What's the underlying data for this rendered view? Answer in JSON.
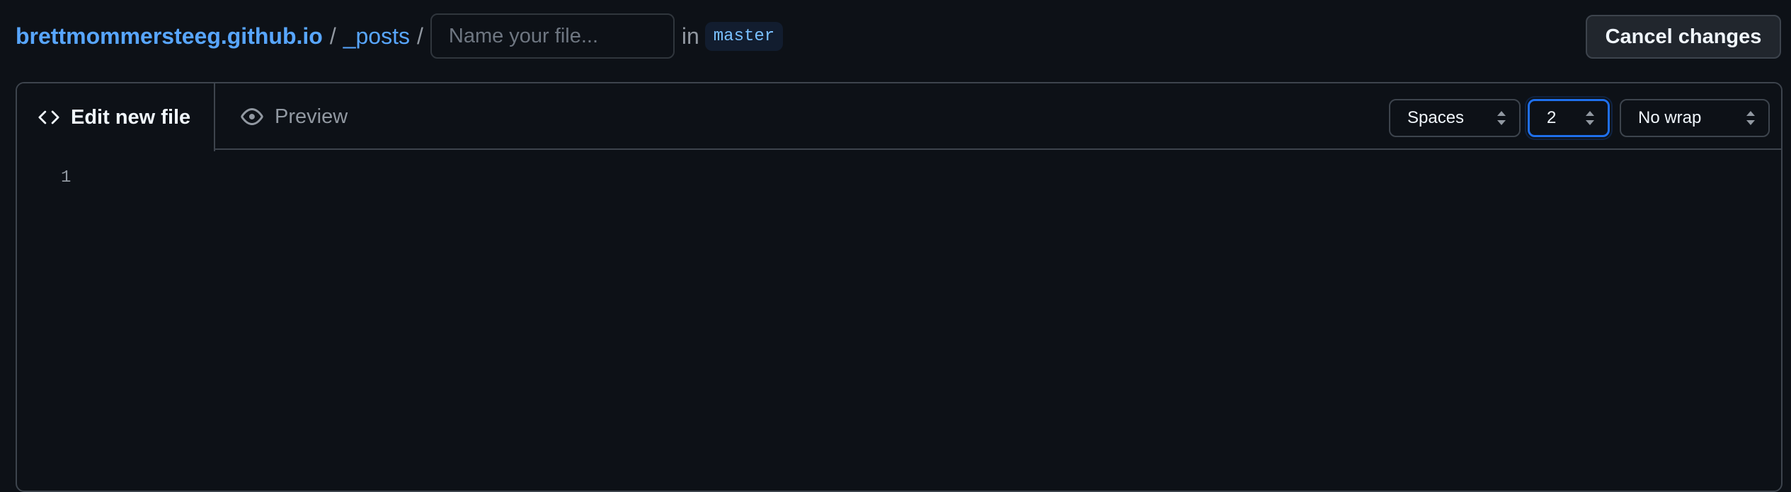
{
  "breadcrumb": {
    "repo": "brettmommersteeg.github.io",
    "separator": "/",
    "dir": "_posts"
  },
  "filename": {
    "value": "",
    "placeholder": "Name your file..."
  },
  "branch": {
    "prefix": "in",
    "name": "master"
  },
  "cancel_button": "Cancel changes",
  "tabs": [
    {
      "label": "Edit new file",
      "icon": "code-icon"
    },
    {
      "label": "Preview",
      "icon": "eye-icon"
    }
  ],
  "options": {
    "indent_mode": "Spaces",
    "indent_size": "2",
    "wrap_mode": "No wrap"
  },
  "editor": {
    "line_numbers": [
      "1"
    ]
  },
  "colors": {
    "background": "#0d1117",
    "link": "#58a6ff",
    "focus": "#1f6feb",
    "border": "#3d444d"
  }
}
